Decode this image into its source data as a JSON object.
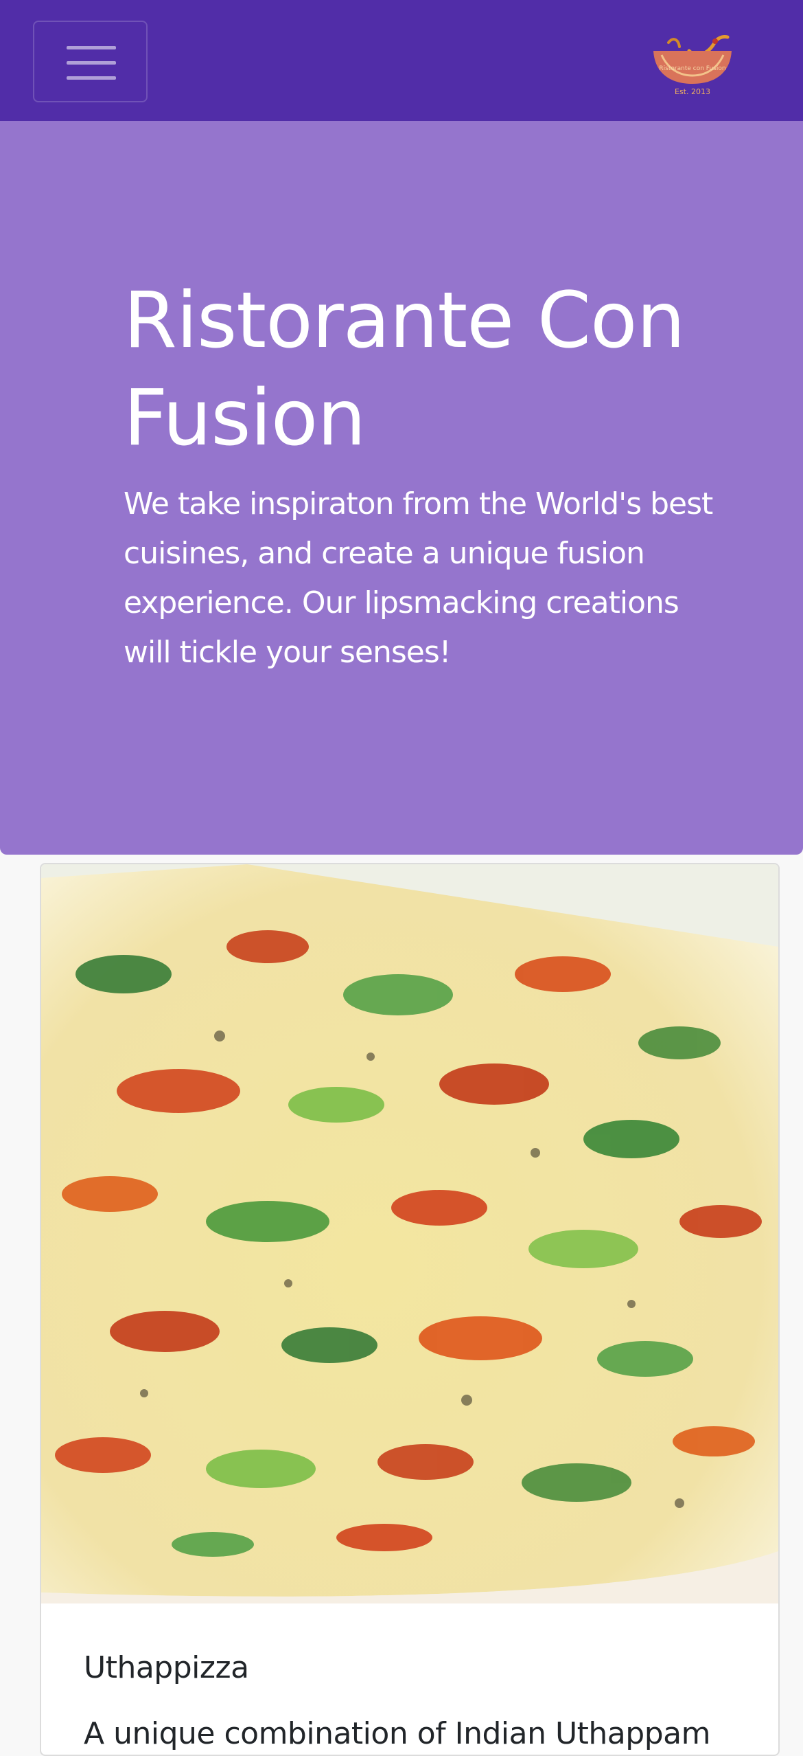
{
  "navbar": {
    "menu_icon": "hamburger-menu-icon",
    "logo": {
      "icon": "restaurant-logo",
      "text": "Ristorante con Fusion",
      "est": "Est. 2013"
    },
    "colors": {
      "background": "#512DA8"
    }
  },
  "jumbotron": {
    "title": "Ristorante Con Fusion",
    "text": "We take inspiraton from the World's best cuisines, and create a unique fusion experience. Our lipsmacking creations will tickle your senses!",
    "colors": {
      "background": "#9575CD",
      "text": "#FFFFFF"
    }
  },
  "featured": {
    "image_icon": "uthappizza-photo",
    "title": "Uthappizza",
    "text": "A unique combination of Indian Uthappam"
  }
}
